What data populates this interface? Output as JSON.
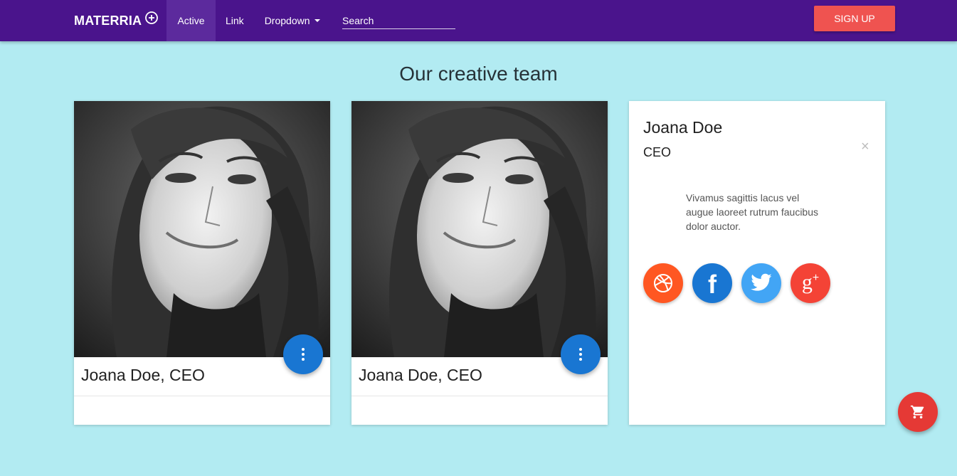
{
  "navbar": {
    "brand": "MATERRIA",
    "items": [
      {
        "label": "Active"
      },
      {
        "label": "Link"
      },
      {
        "label": "Dropdown"
      }
    ],
    "search_placeholder": "Search",
    "signup_label": "SIGN UP"
  },
  "page": {
    "title": "Our creative team"
  },
  "cards": [
    {
      "caption": "Joana Doe, CEO"
    },
    {
      "caption": "Joana Doe, CEO"
    }
  ],
  "detail": {
    "name": "Joana Doe",
    "role": "CEO",
    "close": "×",
    "text": "Vivamus sagittis lacus vel augue laoreet rutrum faucibus dolor auctor.",
    "social": [
      {
        "icon": "dribbble-icon",
        "color": "#ff5722"
      },
      {
        "icon": "facebook-icon",
        "color": "#1976d2"
      },
      {
        "icon": "twitter-icon",
        "color": "#42a5f5"
      },
      {
        "icon": "google-plus-icon",
        "color": "#f44336"
      }
    ]
  },
  "colors": {
    "navbar": "#4a148c",
    "background": "#b2ebf2",
    "signup": "#ef5350",
    "fab_more": "#1976d2",
    "fab_cart": "#e53935"
  }
}
